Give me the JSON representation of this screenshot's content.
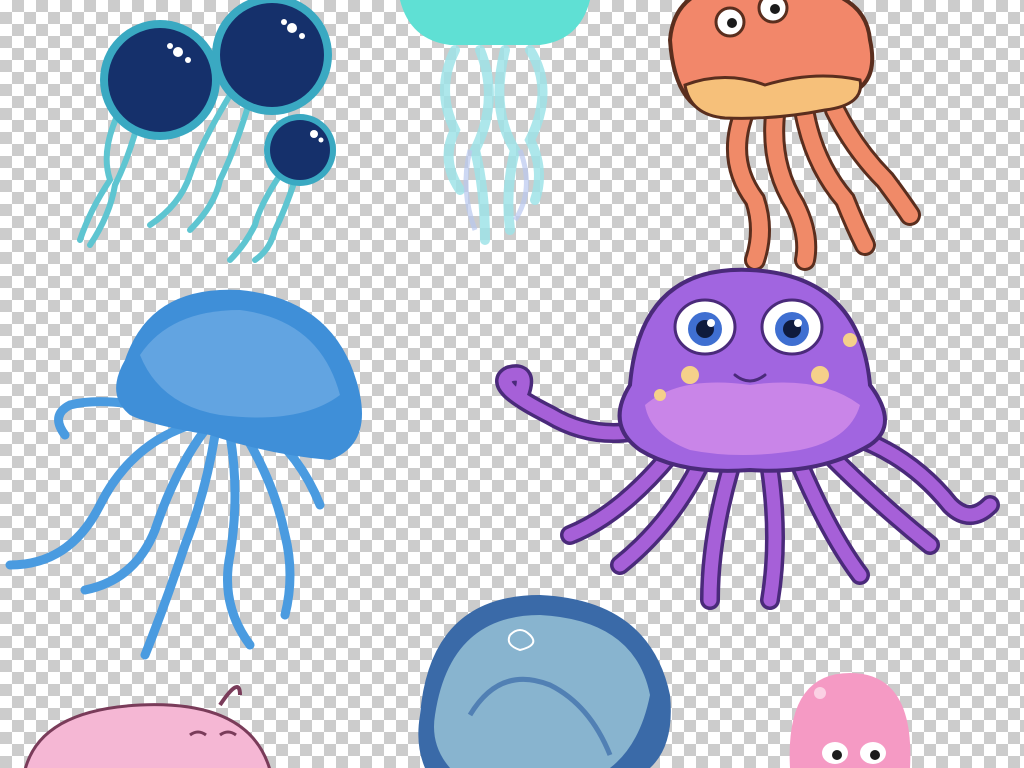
{
  "canvas": {
    "background": "transparency-checkerboard",
    "checker_light": "#ffffff",
    "checker_dark": "#cccccc"
  },
  "jellyfish": [
    {
      "id": "navy-trio",
      "style": "cartoon",
      "count": 3,
      "bell_color": "#15306b",
      "rim_color": "#3aa9c2",
      "tentacle_color": "#5ec5d1"
    },
    {
      "id": "aqua-glow",
      "style": "glowing",
      "bell_color": "#5fe0d4",
      "tentacle_color": "#9fe3e8"
    },
    {
      "id": "orange-cartoon",
      "style": "cartoon-eyes",
      "bell_color": "#f2876a",
      "rim_color": "#f6c07a",
      "tentacle_color": "#f08a68"
    },
    {
      "id": "blue-watercolor",
      "style": "watercolor",
      "bell_color": "#3f8fd8",
      "tentacle_color": "#4a9be0"
    },
    {
      "id": "purple-smiling",
      "style": "cartoon-eyes",
      "bell_color": "#a165e0",
      "spot_color": "#f5d08a",
      "tentacle_color": "#a660d8",
      "eye_color": "#3f6fd1"
    },
    {
      "id": "pink-partial-left",
      "style": "cartoon",
      "bell_color": "#f5b7d4"
    },
    {
      "id": "watercolor-bottom",
      "style": "watercolor",
      "bell_color": "#3a6aa8"
    },
    {
      "id": "pink-partial-right",
      "style": "cartoon-eyes",
      "bell_color": "#f59ac4"
    }
  ]
}
